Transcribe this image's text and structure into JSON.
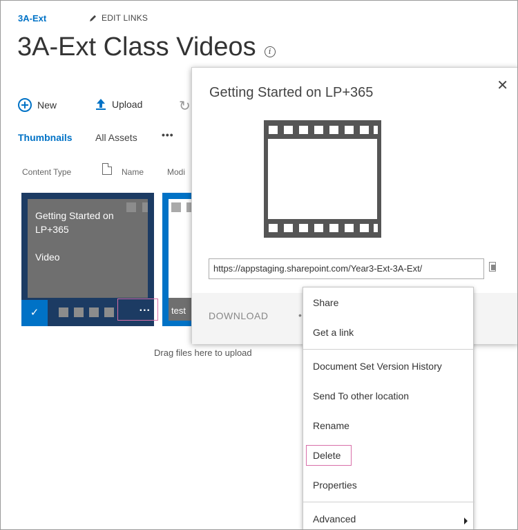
{
  "header": {
    "site_name": "3A-Ext",
    "edit_links": "EDIT LINKS",
    "title": "3A-Ext Class Videos"
  },
  "commands": {
    "new": "New",
    "upload": "Upload"
  },
  "views": {
    "thumbnails": "Thumbnails",
    "all_assets": "All Assets",
    "more": "•••"
  },
  "columns": {
    "content_type": "Content Type",
    "name": "Name",
    "modified": "Modi"
  },
  "tiles": [
    {
      "title": "Getting Started on LP+365",
      "type": "Video",
      "dots": "..."
    },
    {
      "label": "test"
    }
  ],
  "drag_text": "Drag files here to upload",
  "callout": {
    "title": "Getting Started on LP+365",
    "close": "✕",
    "url": "https://appstaging.sharepoint.com/Year3-Ext-3A-Ext/",
    "download": "DOWNLOAD"
  },
  "context_menu": {
    "items": [
      "Share",
      "Get a link",
      "Document Set Version History",
      "Send To other location",
      "Rename",
      "Delete",
      "Properties",
      "Advanced"
    ]
  },
  "colors": {
    "accent": "#0072c6",
    "tile_bg": "#1c3b63",
    "highlight": "#d86ea8"
  }
}
